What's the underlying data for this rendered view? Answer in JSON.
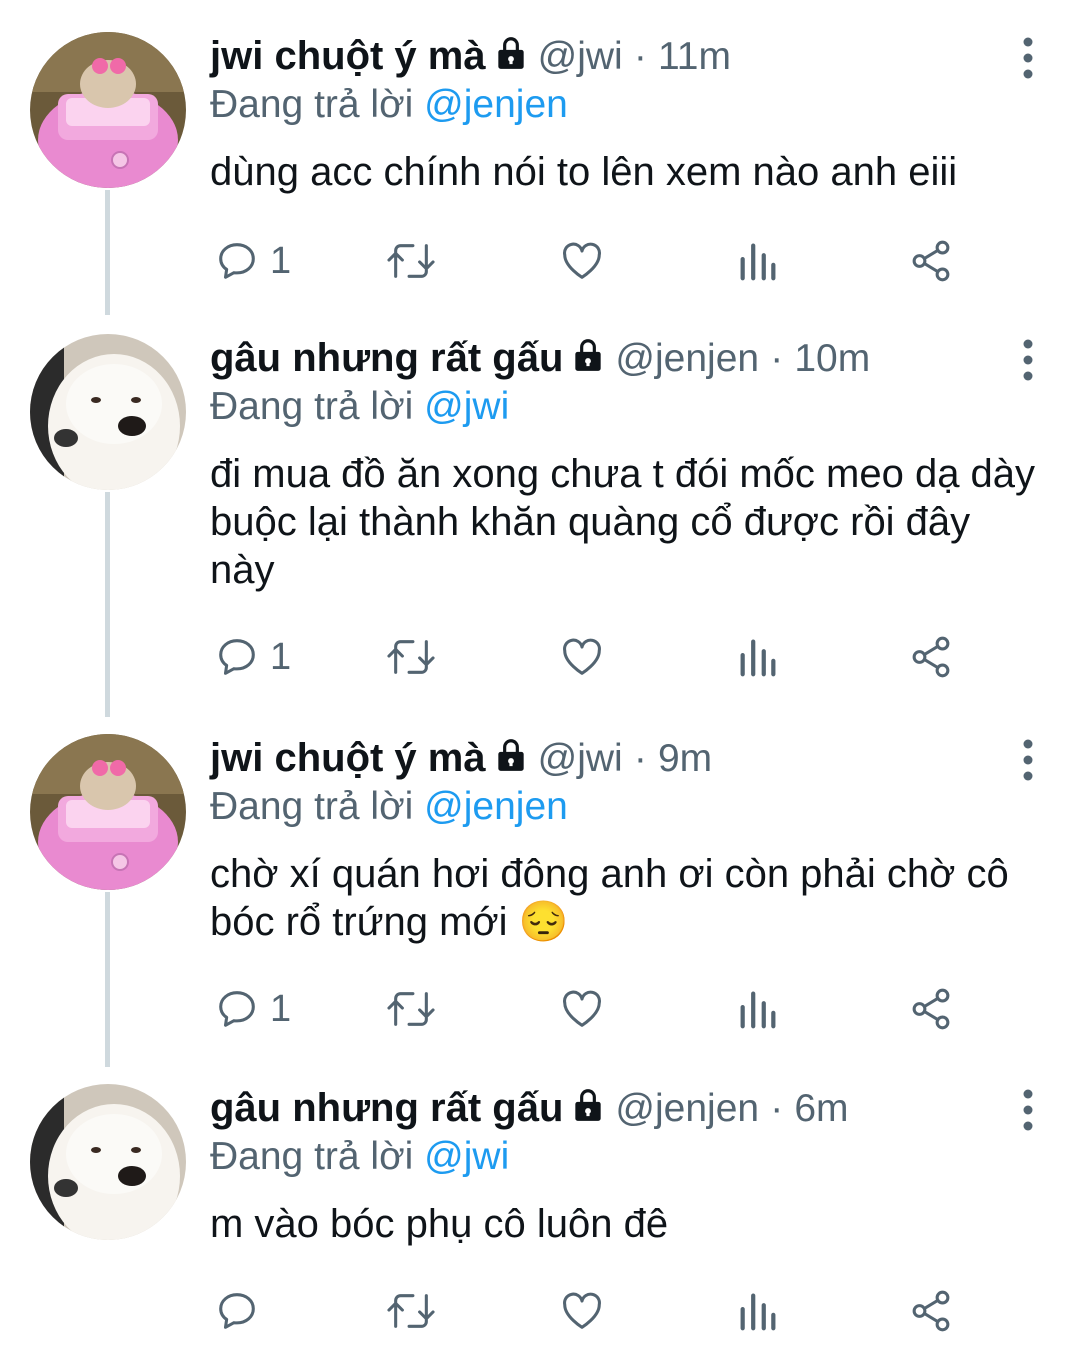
{
  "tweets": [
    {
      "name": "jwi chuột ý mà",
      "handle": "@jwi",
      "dot": "·",
      "time": "11m",
      "reply_prefix": "Đang trả lời",
      "reply_to": "@jenjen",
      "text": "dùng acc chính nói to lên xem nào anh eiii",
      "reply_count": "1",
      "avatar": "hamster-pink-car"
    },
    {
      "name": "gâu nhưng rất gấu",
      "handle": "@jenjen",
      "dot": "·",
      "time": "10m",
      "reply_prefix": "Đang trả lời",
      "reply_to": "@jwi",
      "text": "đi mua đồ ăn xong chưa t đói mốc meo dạ dày buộc lại thành khăn quàng cổ được rồi đây này",
      "reply_count": "1",
      "avatar": "white-dog"
    },
    {
      "name": "jwi chuột ý mà",
      "handle": "@jwi",
      "dot": "·",
      "time": "9m",
      "reply_prefix": "Đang trả lời",
      "reply_to": "@jenjen",
      "text": "chờ xí quán hơi đông anh ơi còn phải chờ cô bóc rổ trứng mới 😔",
      "reply_count": "1",
      "avatar": "hamster-pink-car"
    },
    {
      "name": "gâu nhưng rất gấu",
      "handle": "@jenjen",
      "dot": "·",
      "time": "6m",
      "reply_prefix": "Đang trả lời",
      "reply_to": "@jwi",
      "text": "m vào bóc phụ cô luôn đê",
      "reply_count": "",
      "avatar": "white-dog"
    }
  ],
  "icons": {
    "reply": "speech-bubble-icon",
    "retweet": "retweet-icon",
    "like": "heart-icon",
    "views": "bar-chart-icon",
    "share": "share-icon",
    "lock": "lock-icon",
    "more": "vertical-dots-icon"
  },
  "colors": {
    "text": "#0f1419",
    "secondary": "#536471",
    "mention": "#1d9bf0",
    "thread_line": "#cfd9de"
  }
}
